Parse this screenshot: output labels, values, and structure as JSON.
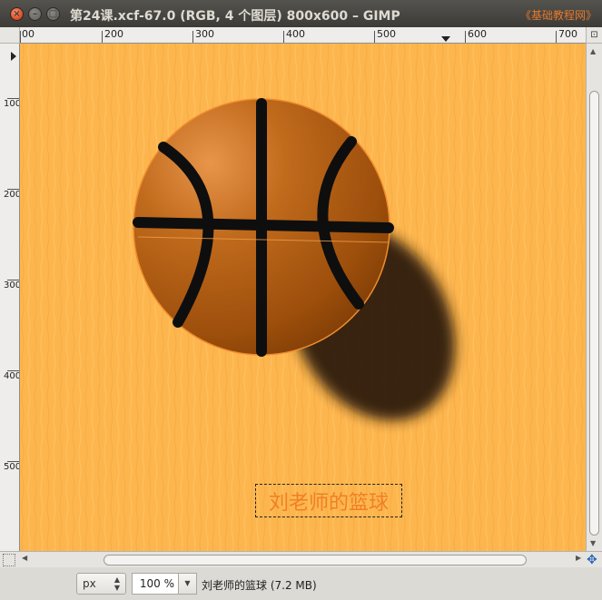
{
  "window": {
    "title": "第24课.xcf-67.0 (RGB, 4 个图层) 800x600 – GIMP",
    "watermark": "《基础教程网》",
    "close_glyph": "×",
    "min_glyph": "–",
    "max_glyph": "□"
  },
  "ruler": {
    "h_labels": [
      "00",
      "200",
      "300",
      "400",
      "500",
      "600",
      "700"
    ],
    "v_labels": [
      "100",
      "200",
      "300",
      "400",
      "500"
    ]
  },
  "canvas": {
    "text_layer": "刘老师的篮球",
    "background_color": "#fdb64e",
    "ball_color": "#b35a0e",
    "line_color": "#0e0e0e",
    "shadow_color": "#2e1f0e",
    "text_color": "#ef7f25"
  },
  "scrollbars": {
    "zoom_icon": "⊡",
    "nav_icon": "✥",
    "up": "▲",
    "down": "▼",
    "left": "◀",
    "right": "▶"
  },
  "statusbar": {
    "unit": "px",
    "zoom_value": "100",
    "zoom_unit": "%",
    "dropdown_arrow": "▼",
    "spin": "▲▼",
    "status": "刘老师的篮球 (7.2 MB)"
  }
}
